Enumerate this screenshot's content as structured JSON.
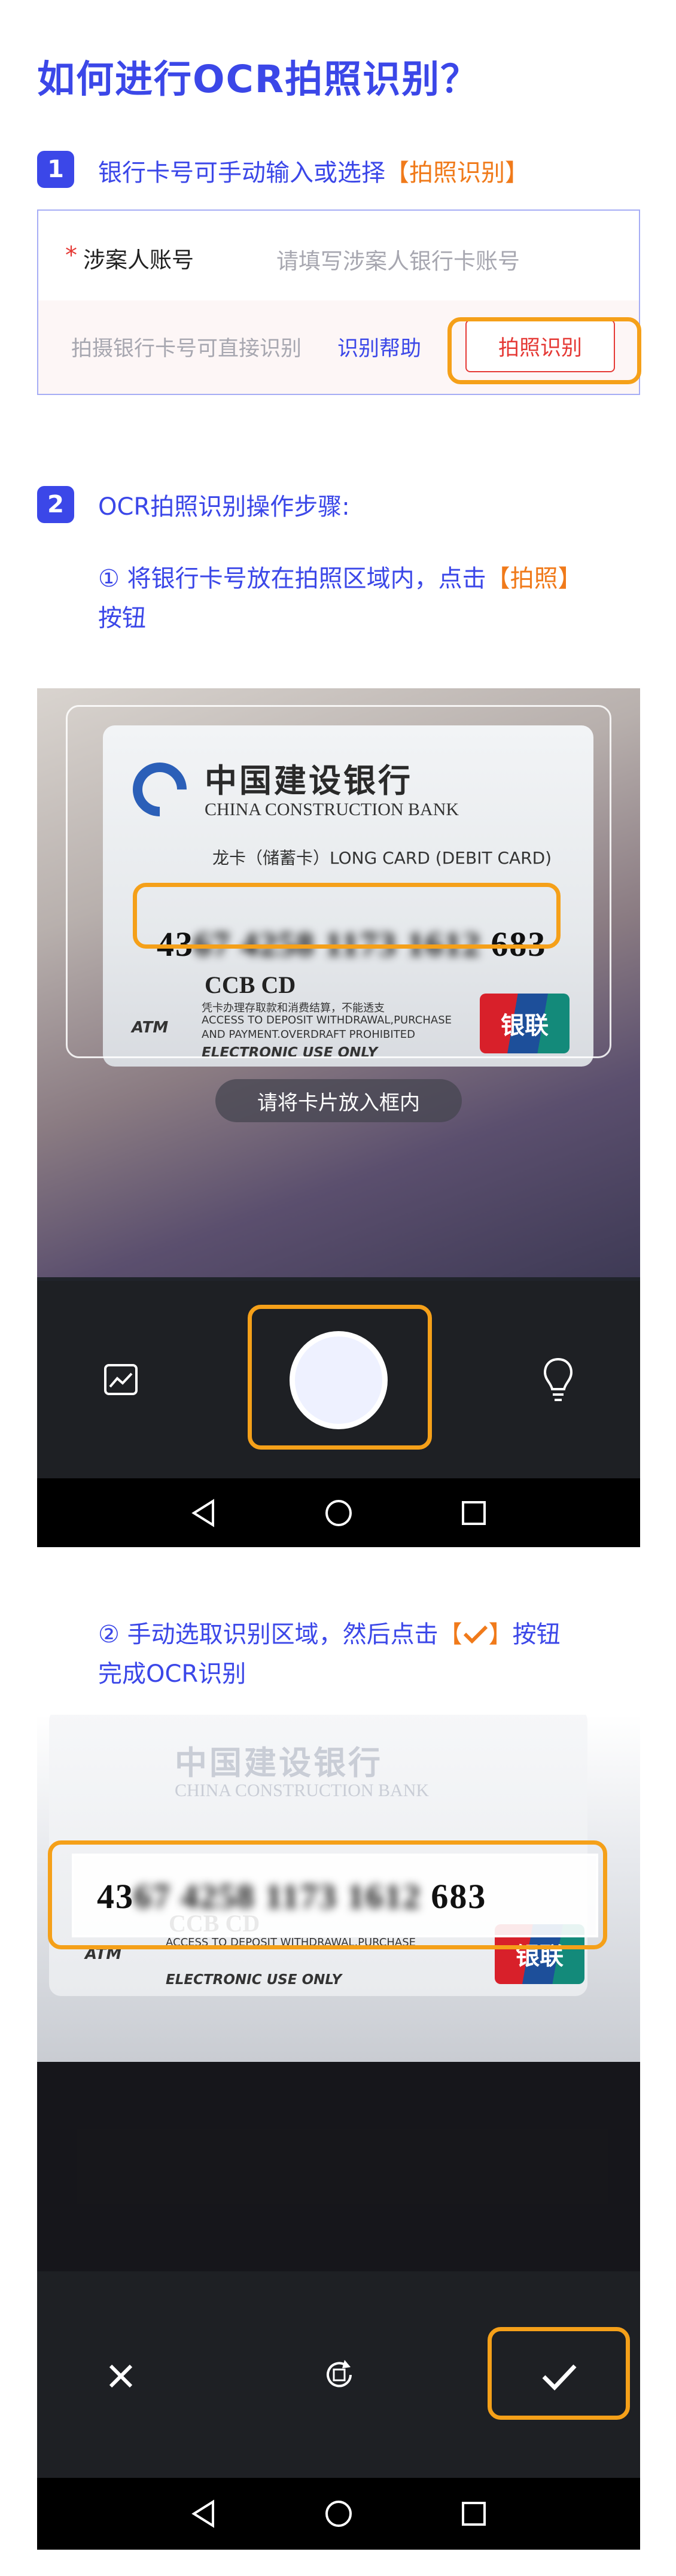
{
  "title": "如何进行OCR拍照识别？",
  "step1": {
    "num": "1",
    "text_prefix": "银行卡号可手动输入或选择",
    "text_highlight": "【拍照识别】"
  },
  "form": {
    "required_mark": "*",
    "account_label": "涉案人账号",
    "account_placeholder": "请填写涉案人银行卡账号",
    "photo_hint": "拍摄银行卡号可直接识别",
    "help_link": "识别帮助",
    "ocr_button": "拍照识别"
  },
  "step2": {
    "num": "2",
    "text": "OCR拍照识别操作步骤:",
    "sub1_prefix": "① 将银行卡号放在拍照区域内，点击",
    "sub1_highlight": "【拍照】",
    "sub1_suffix": "按钮",
    "sub2_prefix": "② 手动选取识别区域，然后点击",
    "sub2_highlight_open": "【",
    "sub2_highlight_close": "】",
    "sub2_suffix": "按钮",
    "sub2_line2": "完成OCR识别"
  },
  "card": {
    "bank_cn": "中国建设银行",
    "bank_en": "CHINA CONSTRUCTION BANK",
    "card_type": "龙卡（储蓄卡）LONG CARD (DEBIT CARD)",
    "num_start": "43",
    "num_blur": "67 4258 1173 1612",
    "num_end": "683",
    "ccb_cd": "CCB CD",
    "atm": "ATM",
    "fine_print1": "凭卡办理存取款和消费结算，不能透支",
    "fine_print2": "ACCESS TO DEPOSIT WITHDRAWAL,PURCHASE",
    "fine_print3": "AND PAYMENT.OVERDRAFT PROHIBITED",
    "electronic": "ELECTRONIC USE ONLY",
    "unionpay": "银联"
  },
  "camera": {
    "hint": "请将卡片放入框内",
    "gallery_icon": "gallery-icon",
    "flash_icon": "bulb-icon"
  },
  "crop": {
    "cancel_icon": "close-icon",
    "rotate_icon": "rotate-icon",
    "confirm_icon": "check-icon"
  },
  "nav": {
    "back_icon": "triangle-back-icon",
    "home_icon": "circle-home-icon",
    "recent_icon": "square-recent-icon"
  },
  "colors": {
    "accent": "#3b47e8",
    "highlight": "#f07a1a",
    "outline": "#f5a019",
    "required": "#e53935"
  }
}
